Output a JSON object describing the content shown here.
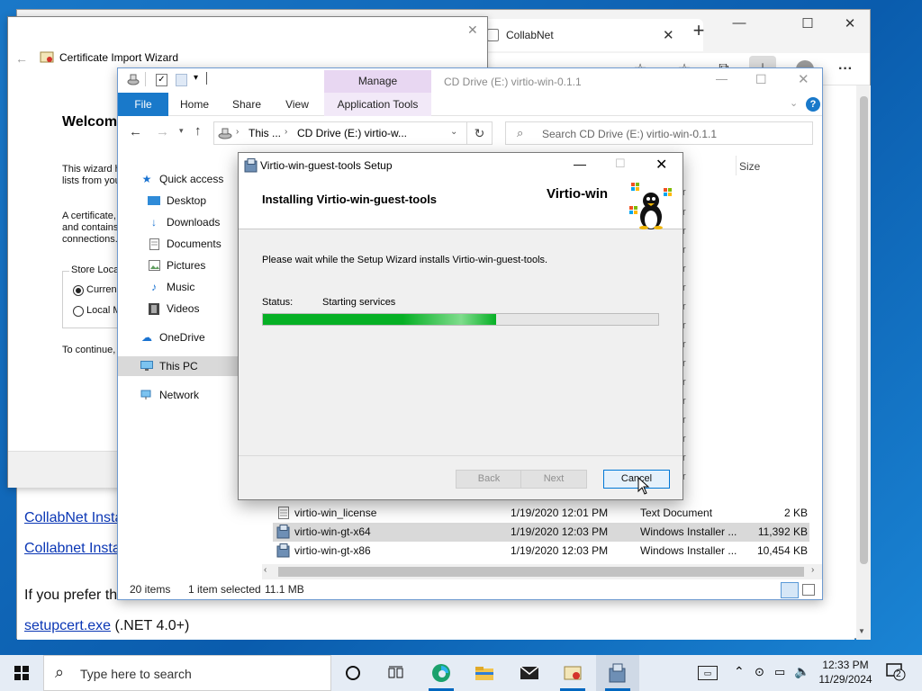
{
  "browser": {
    "tab_title": "CollabNet",
    "tab_close": "✕",
    "new_tab": "+",
    "window_controls": {
      "minimize": "—",
      "maximize": "☐",
      "close": "✕"
    },
    "menu": "···",
    "links": [
      "CollabNet Insta",
      "Collabnet Insta"
    ],
    "prefer_text": "If you prefer th",
    "setupcert_link": "setupcert.exe",
    "setupcert_suffix": " (.NET 4.0+)"
  },
  "certwiz": {
    "title": "Certificate Import Wizard",
    "heading": "Welcom",
    "para1_line1": "This wizard h",
    "para1_line2": "lists from you",
    "para2_line1": "A certificate,",
    "para2_line2": "and contains",
    "para2_line3": "connections.",
    "store_label": "Store Loca",
    "radio_current": "Curren",
    "radio_local": "Local M",
    "continue_text": "To continue,",
    "close": "✕"
  },
  "explorer": {
    "title": "CD Drive (E:) virtio-win-0.1.1",
    "ribbon_tabs": {
      "file": "File",
      "home": "Home",
      "share": "Share",
      "view": "View"
    },
    "manage": "Manage",
    "app_tools": "Application Tools",
    "breadcrumb_this": "This ...",
    "breadcrumb_drive": "CD Drive (E:) virtio-w...",
    "search_placeholder": "Search CD Drive (E:) virtio-win-0.1.1",
    "column_size": "Size",
    "nav": [
      "Quick access",
      "Desktop",
      "Downloads",
      "Documents",
      "Pictures",
      "Music",
      "Videos",
      "OneDrive",
      "This PC",
      "Network"
    ],
    "files": [
      {
        "name": "virtio-win_license",
        "date": "1/19/2020 12:01 PM",
        "type": "Text Document",
        "size": "2 KB"
      },
      {
        "name": "virtio-win-gt-x64",
        "date": "1/19/2020 12:03 PM",
        "type": "Windows Installer ...",
        "size": "11,392 KB"
      },
      {
        "name": "virtio-win-gt-x86",
        "date": "1/19/2020 12:03 PM",
        "type": "Windows Installer ...",
        "size": "10,454 KB"
      }
    ],
    "partial_r": "r",
    "status_items": "20 items",
    "status_selected": "1 item selected",
    "status_size": "11.1 MB"
  },
  "setup": {
    "title": "Virtio-win-guest-tools Setup",
    "heading": "Installing Virtio-win-guest-tools",
    "brand": "Virtio-win",
    "wait_text": "Please wait while the Setup Wizard installs Virtio-win-guest-tools.",
    "status_label": "Status:",
    "status_value": "Starting services",
    "progress_fraction": 0.59,
    "progress_color": "#06b025",
    "buttons": {
      "back": "Back",
      "next": "Next",
      "cancel": "Cancel"
    }
  },
  "taskbar": {
    "search_placeholder": "Type here to search",
    "time": "12:33 PM",
    "date": "11/29/2024",
    "notification_count": "2"
  }
}
